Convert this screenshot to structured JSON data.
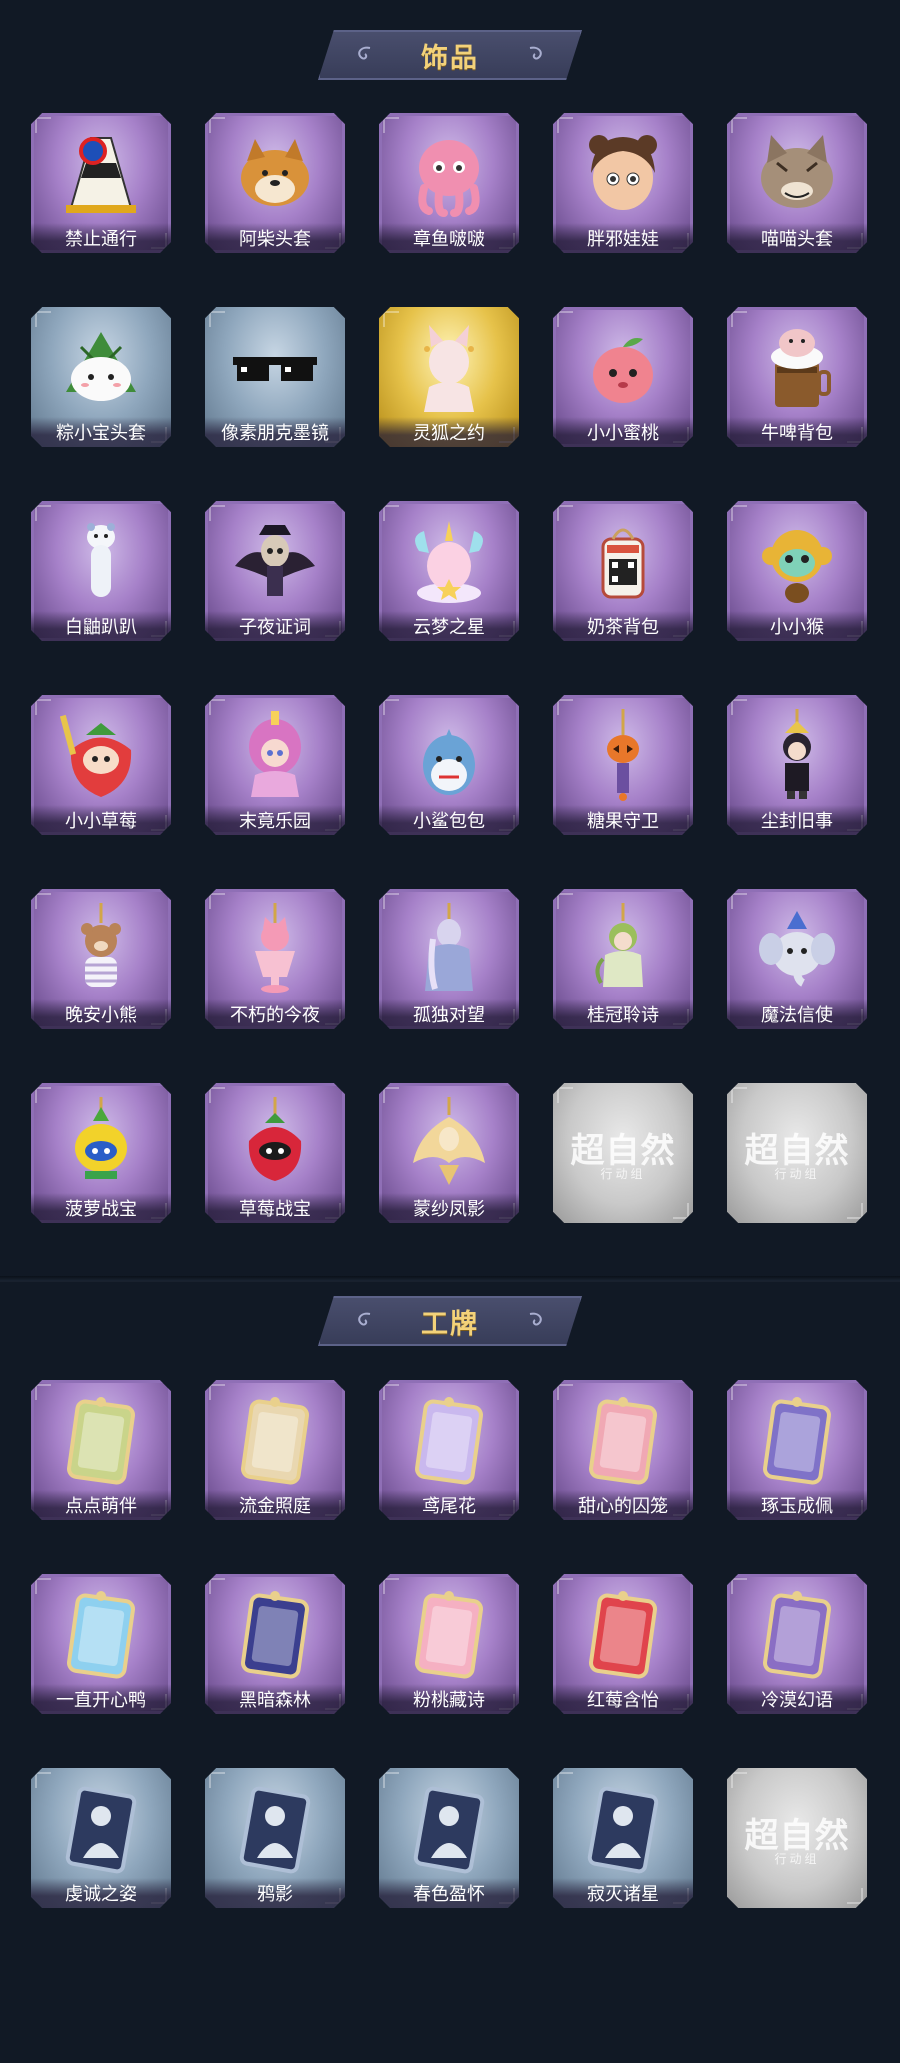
{
  "accessories": {
    "title": "饰品",
    "items": [
      {
        "label": "禁止通行",
        "rarity": "purple",
        "icon": "traffic-cone-icon"
      },
      {
        "label": "阿柴头套",
        "rarity": "purple",
        "icon": "shiba-head-icon"
      },
      {
        "label": "章鱼啵啵",
        "rarity": "purple",
        "icon": "octopus-icon"
      },
      {
        "label": "胖邪娃娃",
        "rarity": "purple",
        "icon": "doll-head-icon"
      },
      {
        "label": "喵喵头套",
        "rarity": "purple",
        "icon": "cat-head-icon"
      },
      {
        "label": "粽小宝头套",
        "rarity": "blue",
        "icon": "zongzi-head-icon"
      },
      {
        "label": "像素朋克墨镜",
        "rarity": "blue",
        "icon": "pixel-sunglasses-icon"
      },
      {
        "label": "灵狐之约",
        "rarity": "gold",
        "icon": "fox-spirit-icon"
      },
      {
        "label": "小小蜜桃",
        "rarity": "purple",
        "icon": "peach-icon"
      },
      {
        "label": "牛啤背包",
        "rarity": "purple",
        "icon": "beer-backpack-icon"
      },
      {
        "label": "白鼬趴趴",
        "rarity": "purple",
        "icon": "ferret-icon"
      },
      {
        "label": "子夜证词",
        "rarity": "purple",
        "icon": "owl-doll-icon"
      },
      {
        "label": "云梦之星",
        "rarity": "purple",
        "icon": "unicorn-icon"
      },
      {
        "label": "奶茶背包",
        "rarity": "purple",
        "icon": "milk-tea-backpack-icon"
      },
      {
        "label": "小小猴",
        "rarity": "purple",
        "icon": "monkey-icon"
      },
      {
        "label": "小小草莓",
        "rarity": "purple",
        "icon": "strawberry-doll-icon"
      },
      {
        "label": "末竟乐园",
        "rarity": "purple",
        "icon": "clown-girl-icon"
      },
      {
        "label": "小鲨包包",
        "rarity": "purple",
        "icon": "shark-bag-icon"
      },
      {
        "label": "糖果守卫",
        "rarity": "purple",
        "icon": "pumpkin-charm-icon"
      },
      {
        "label": "尘封旧事",
        "rarity": "purple",
        "icon": "boy-charm-icon"
      },
      {
        "label": "晚安小熊",
        "rarity": "purple",
        "icon": "bear-charm-icon"
      },
      {
        "label": "不朽的今夜",
        "rarity": "purple",
        "icon": "cat-cup-charm-icon"
      },
      {
        "label": "孤独对望",
        "rarity": "purple",
        "icon": "figure-charm-icon"
      },
      {
        "label": "桂冠聆诗",
        "rarity": "purple",
        "icon": "laurel-charm-icon"
      },
      {
        "label": "魔法信使",
        "rarity": "purple",
        "icon": "elephant-charm-icon"
      },
      {
        "label": "菠萝战宝",
        "rarity": "purple",
        "icon": "pineapple-robot-icon"
      },
      {
        "label": "草莓战宝",
        "rarity": "purple",
        "icon": "strawberry-robot-icon"
      },
      {
        "label": "蒙纱凤影",
        "rarity": "purple",
        "icon": "phoenix-charm-icon"
      },
      {
        "label": "",
        "rarity": "gray",
        "placeholder": "超自然",
        "placeholder_sub": "行动组"
      },
      {
        "label": "",
        "rarity": "gray",
        "placeholder": "超自然",
        "placeholder_sub": "行动组"
      }
    ]
  },
  "badges": {
    "title": "工牌",
    "items": [
      {
        "label": "点点萌伴",
        "rarity": "purple",
        "icon": "badge-card-icon",
        "color": "#c9d48a"
      },
      {
        "label": "流金照庭",
        "rarity": "purple",
        "icon": "badge-card-icon",
        "color": "#e9d7b0"
      },
      {
        "label": "鸢尾花",
        "rarity": "purple",
        "icon": "badge-card-icon",
        "color": "#c9b8ee"
      },
      {
        "label": "甜心的囚笼",
        "rarity": "purple",
        "icon": "badge-card-icon",
        "color": "#f0a8b4"
      },
      {
        "label": "琢玉成佩",
        "rarity": "purple",
        "icon": "badge-card-icon",
        "color": "#7f72c8"
      },
      {
        "label": "一直开心鸭",
        "rarity": "purple",
        "icon": "badge-card-icon",
        "color": "#8ed0ef"
      },
      {
        "label": "黑暗森林",
        "rarity": "purple",
        "icon": "badge-card-icon",
        "color": "#3b3f8f"
      },
      {
        "label": "粉桃藏诗",
        "rarity": "purple",
        "icon": "badge-card-icon",
        "color": "#f5b0c2"
      },
      {
        "label": "红莓含怡",
        "rarity": "purple",
        "icon": "badge-card-icon",
        "color": "#e0444c"
      },
      {
        "label": "冷漠幻语",
        "rarity": "purple",
        "icon": "badge-card-icon",
        "color": "#8a6ec4"
      },
      {
        "label": "虔诚之姿",
        "rarity": "blue",
        "icon": "silhouette-card-icon"
      },
      {
        "label": "鸦影",
        "rarity": "blue",
        "icon": "silhouette-card-icon"
      },
      {
        "label": "春色盈怀",
        "rarity": "blue",
        "icon": "silhouette-card-icon"
      },
      {
        "label": "寂灭诸星",
        "rarity": "blue",
        "icon": "silhouette-card-icon"
      },
      {
        "label": "",
        "rarity": "gray",
        "placeholder": "超自然",
        "placeholder_sub": "行动组"
      }
    ]
  }
}
